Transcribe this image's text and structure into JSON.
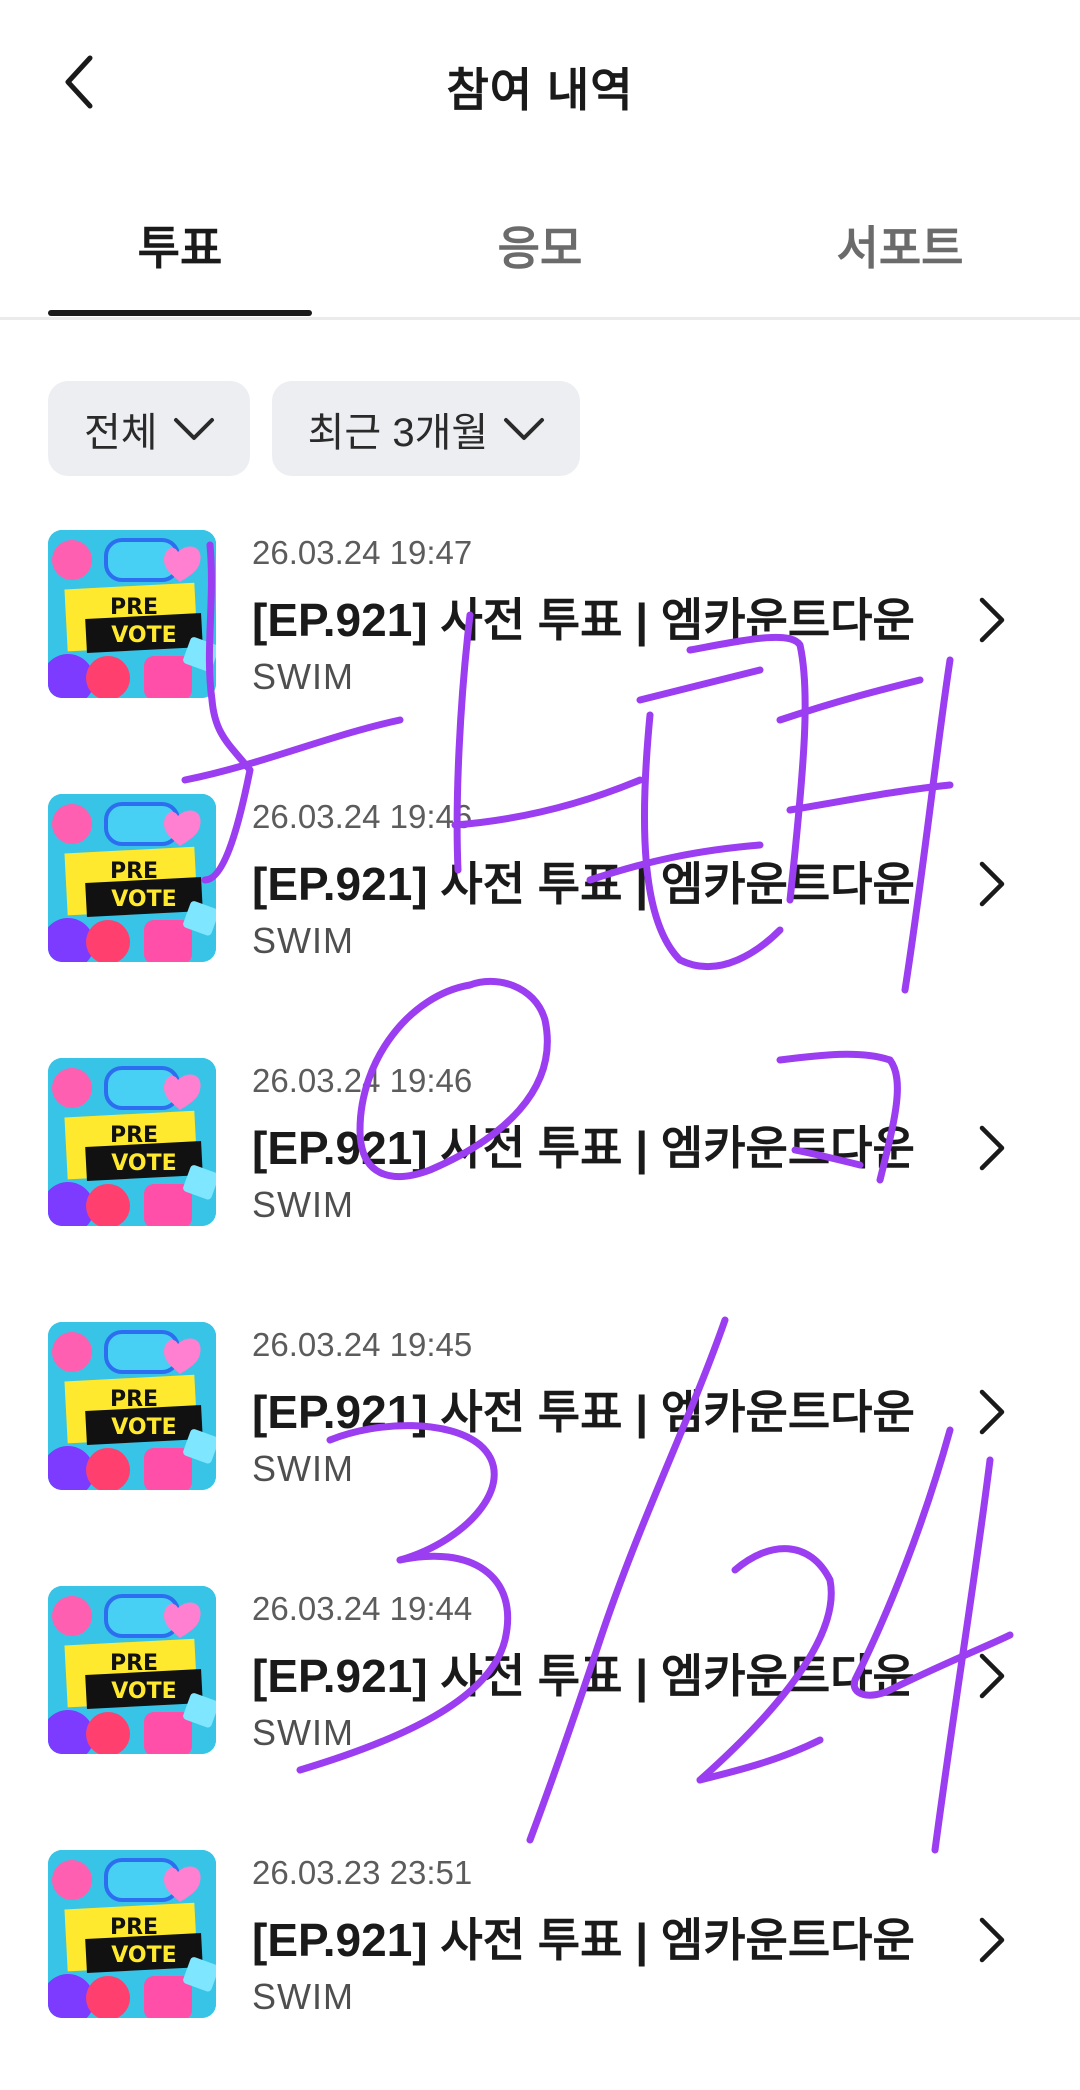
{
  "header": {
    "title": "참여 내역"
  },
  "tabs": [
    {
      "label": "투표",
      "active": true
    },
    {
      "label": "응모",
      "active": false
    },
    {
      "label": "서포트",
      "active": false
    }
  ],
  "filters": [
    {
      "label": "전체"
    },
    {
      "label": "최근 3개월"
    }
  ],
  "items": [
    {
      "date": "26.03.24 19:47",
      "title": "[EP.921] 사전 투표 | 엠카운트다운",
      "sub": "SWIM"
    },
    {
      "date": "26.03.24 19:46",
      "title": "[EP.921] 사전 투표 | 엠카운트다운",
      "sub": "SWIM"
    },
    {
      "date": "26.03.24 19:46",
      "title": "[EP.921] 사전 투표 | 엠카운트다운",
      "sub": "SWIM"
    },
    {
      "date": "26.03.24 19:45",
      "title": "[EP.921] 사전 투표 | 엠카운트다운",
      "sub": "SWIM"
    },
    {
      "date": "26.03.24 19:44",
      "title": "[EP.921] 사전 투표 | 엠카운트다운",
      "sub": "SWIM"
    },
    {
      "date": "26.03.23 23:51",
      "title": "[EP.921] 사전 투표 | 엠카운트다운",
      "sub": "SWIM"
    }
  ],
  "thumbnail": {
    "line1": "PRE",
    "line2": "VOTE"
  },
  "colors": {
    "annotation": "#9b3df0",
    "accent": "#1a1a1a",
    "filter_bg": "#eceef1"
  },
  "annotation": {
    "description": "handwritten purple marker overlay"
  }
}
